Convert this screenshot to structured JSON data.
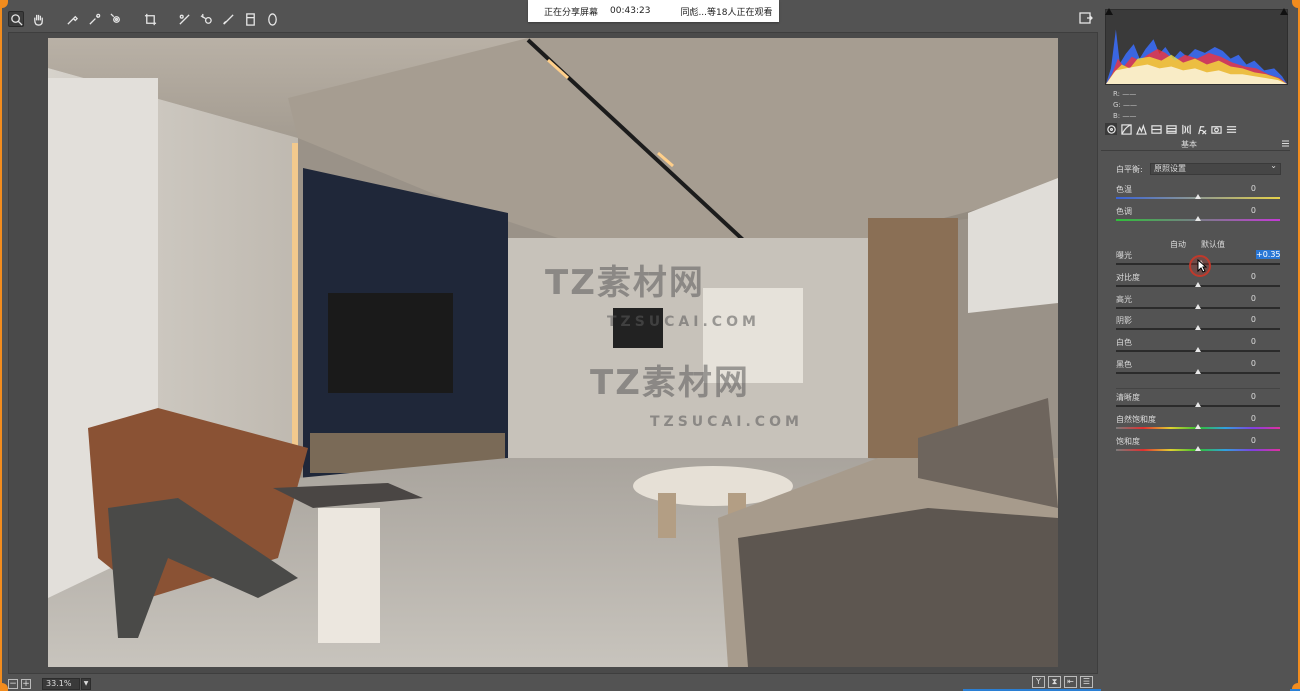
{
  "share_banner": {
    "sharing_text": "正在分享屏幕",
    "elapsed": "00:43:23",
    "viewers": "同彪...等18人正在观看"
  },
  "watermark": {
    "brand": "TZ素材网",
    "domain": "TZSUCAI.COM"
  },
  "toolbar": {
    "tools": [
      "zoom-tool",
      "hand-tool",
      "white-balance-tool",
      "color-sampler-tool",
      "targeted-adjustment-tool",
      "crop-tool",
      "straighten-tool",
      "spot-removal-tool",
      "red-eye-tool",
      "adjustment-brush",
      "graduated-filter",
      "radial-filter"
    ]
  },
  "histogram": {
    "r_label": "R:",
    "g_label": "G:",
    "b_label": "B:",
    "r_value": "——",
    "g_value": "——",
    "b_value": "——"
  },
  "panel": {
    "title": "基本",
    "white_balance_label": "白平衡:",
    "white_balance_value": "原照设置",
    "auto_label": "自动",
    "default_label": "默认值",
    "sliders": [
      {
        "label": "色温",
        "value": "0",
        "pos": 0.5,
        "track": "temp"
      },
      {
        "label": "色调",
        "value": "0",
        "pos": 0.5,
        "track": "tint"
      },
      {
        "label": "曝光",
        "value": "+0.35",
        "pos": 0.52,
        "track": "plain",
        "highlight": true
      },
      {
        "label": "对比度",
        "value": "0",
        "pos": 0.5,
        "track": "plain"
      },
      {
        "label": "高光",
        "value": "0",
        "pos": 0.5,
        "track": "plain"
      },
      {
        "label": "阴影",
        "value": "0",
        "pos": 0.5,
        "track": "plain"
      },
      {
        "label": "白色",
        "value": "0",
        "pos": 0.5,
        "track": "plain"
      },
      {
        "label": "黑色",
        "value": "0",
        "pos": 0.5,
        "track": "plain"
      },
      {
        "label": "清晰度",
        "value": "0",
        "pos": 0.5,
        "track": "plain"
      },
      {
        "label": "自然饱和度",
        "value": "0",
        "pos": 0.5,
        "track": "sat"
      },
      {
        "label": "饱和度",
        "value": "0",
        "pos": 0.5,
        "track": "sat"
      }
    ]
  },
  "status": {
    "zoom": "33.1%",
    "zoom_out": "−",
    "zoom_in": "+"
  },
  "view_buttons": [
    "Y",
    "⧗",
    "⇤",
    "☰"
  ],
  "colors": {
    "accent": "#f28c1e",
    "highlight": "#2a77d6",
    "panel_bg": "#535353"
  }
}
